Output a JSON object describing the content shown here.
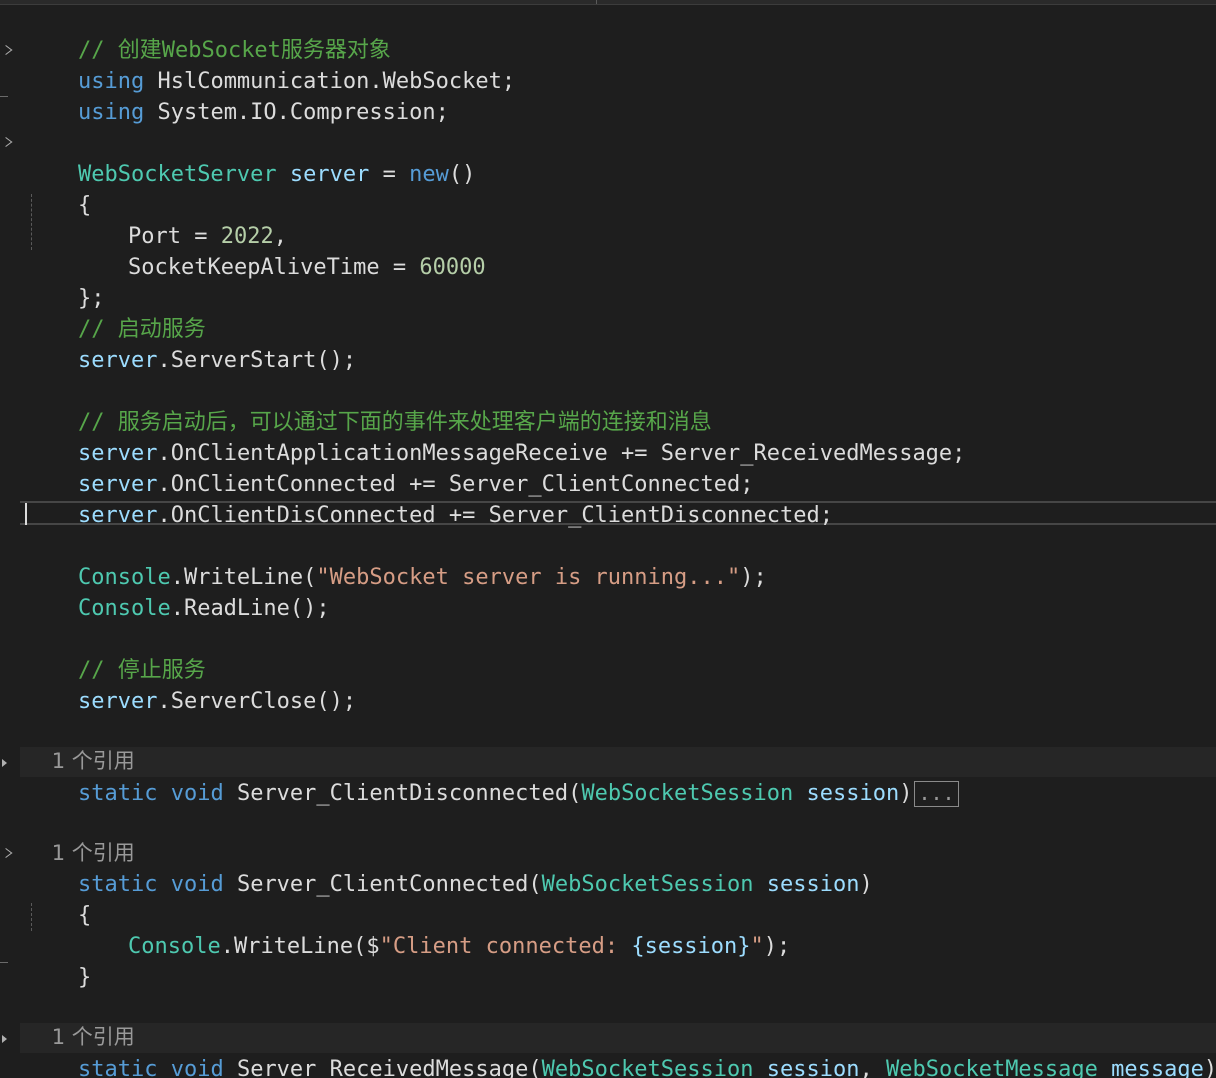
{
  "editor": {
    "line1": {
      "comment": "// 创建WebSocket服务器对象"
    },
    "line2": {
      "kw": "using",
      "rest": " HslCommunication.WebSocket;"
    },
    "line3": {
      "kw": "using",
      "rest": " System.IO.Compression;"
    },
    "line5": {
      "type": "WebSocketServer",
      "var": " server",
      "op": " = ",
      "kw": "new",
      "rest": "()"
    },
    "line6": {
      "text": "{"
    },
    "line7": {
      "prop": "Port",
      "op": " = ",
      "num": "2022",
      "rest": ","
    },
    "line8": {
      "prop": "SocketKeepAliveTime",
      "op": " = ",
      "num": "60000"
    },
    "line9": {
      "text": "};"
    },
    "line10": {
      "comment": "// 启动服务"
    },
    "line11": {
      "obj": "server",
      "rest": ".ServerStart();"
    },
    "line13": {
      "comment": "// 服务启动后，可以通过下面的事件来处理客户端的连接和消息"
    },
    "line14": {
      "obj": "server",
      "rest": ".OnClientApplicationMessageReceive += Server_ReceivedMessage;"
    },
    "line15": {
      "obj": "server",
      "rest": ".OnClientConnected += Server_ClientConnected;"
    },
    "line16": {
      "obj": "server",
      "rest": ".OnClientDisConnected += Server_ClientDisconnected;"
    },
    "line18": {
      "type": "Console",
      "mid": ".WriteLine(",
      "str": "\"WebSocket server is running...\"",
      "rest": ");"
    },
    "line19": {
      "type": "Console",
      "rest": ".ReadLine();"
    },
    "line21": {
      "comment": "// 停止服务"
    },
    "line22": {
      "obj": "server",
      "rest": ".ServerClose();"
    },
    "codelens1": "1 个引用",
    "line24": {
      "kw1": "static",
      "kw2": " void",
      "name": " Server_ClientDisconnected(",
      "type": "WebSocketSession",
      "var": " session",
      "rest": ")",
      "collapsed": "..."
    },
    "codelens2": "1 个引用",
    "line26": {
      "kw1": "static",
      "kw2": " void",
      "name": " Server_ClientConnected(",
      "type": "WebSocketSession",
      "var": " session",
      "rest": ")"
    },
    "line27": {
      "text": "{"
    },
    "line28": {
      "type": "Console",
      "mid": ".WriteLine($",
      "str1": "\"Client connected: ",
      "interp": "{session}",
      "str2": "\"",
      "rest": ");"
    },
    "line29": {
      "text": "}"
    },
    "codelens3": "1 个引用",
    "line31": {
      "kw1": "static",
      "kw2": " void",
      "name": " Server_ReceivedMessage(",
      "type1": "WebSocketSession",
      "var1": " session",
      "sep": ", ",
      "type2": "WebSocketMessage",
      "var2": " message",
      "rest": ")",
      "collapsed": "..."
    }
  },
  "colors": {
    "background": "#1e1e1e",
    "comment": "#57a64a",
    "keyword": "#569cd6",
    "type": "#4ec9b0",
    "string": "#d69d85",
    "number": "#b5cea8",
    "variable": "#9cdcfe"
  }
}
